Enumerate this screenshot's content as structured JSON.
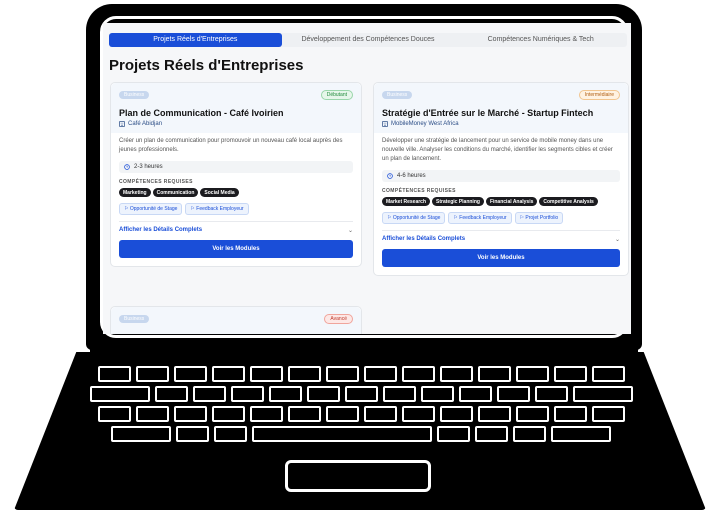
{
  "tabs": [
    {
      "label": "Projets Réels d'Entreprises",
      "active": true
    },
    {
      "label": "Développement des Compétences Douces",
      "active": false
    },
    {
      "label": "Compétences Numériques & Tech",
      "active": false
    }
  ],
  "page_title": "Projets Réels d'Entreprises",
  "labels": {
    "skills_heading": "COMPÉTENCES REQUISES",
    "details_link": "Afficher les Détails Complets",
    "modules_button": "Voir les Modules"
  },
  "cards": [
    {
      "category": "Business",
      "level": "Débutant",
      "level_color": "#1f8a3a",
      "title": "Plan de Communication - Café Ivoirien",
      "company": "Café Abidjan",
      "description": "Créer un plan de communication pour promouvoir un nouveau café local auprès des jeunes professionnels.",
      "duration": "2-3 heures",
      "skills": [
        "Marketing",
        "Communication",
        "Social Media"
      ],
      "perks": [
        "Opportunité de Stage",
        "Feedback Employeur"
      ]
    },
    {
      "category": "Business",
      "level": "Intermédiaire",
      "level_color": "#b05d10",
      "title": "Stratégie d'Entrée sur le Marché - Startup Fintech",
      "company": "MobileMoney West Africa",
      "description": "Développer une stratégie de lancement pour un service de mobile money dans une nouvelle ville. Analyser les conditions du marché, identifier les segments cibles et créer un plan de lancement.",
      "duration": "4-6 heures",
      "skills": [
        "Market Research",
        "Strategic Planning",
        "Financial Analysis",
        "Competitive Analysis"
      ],
      "perks": [
        "Opportunité de Stage",
        "Feedback Employeur",
        "Projet Portfolio"
      ]
    },
    {
      "category": "Business",
      "level": "Avancé",
      "level_color": "#c0392b"
    }
  ]
}
